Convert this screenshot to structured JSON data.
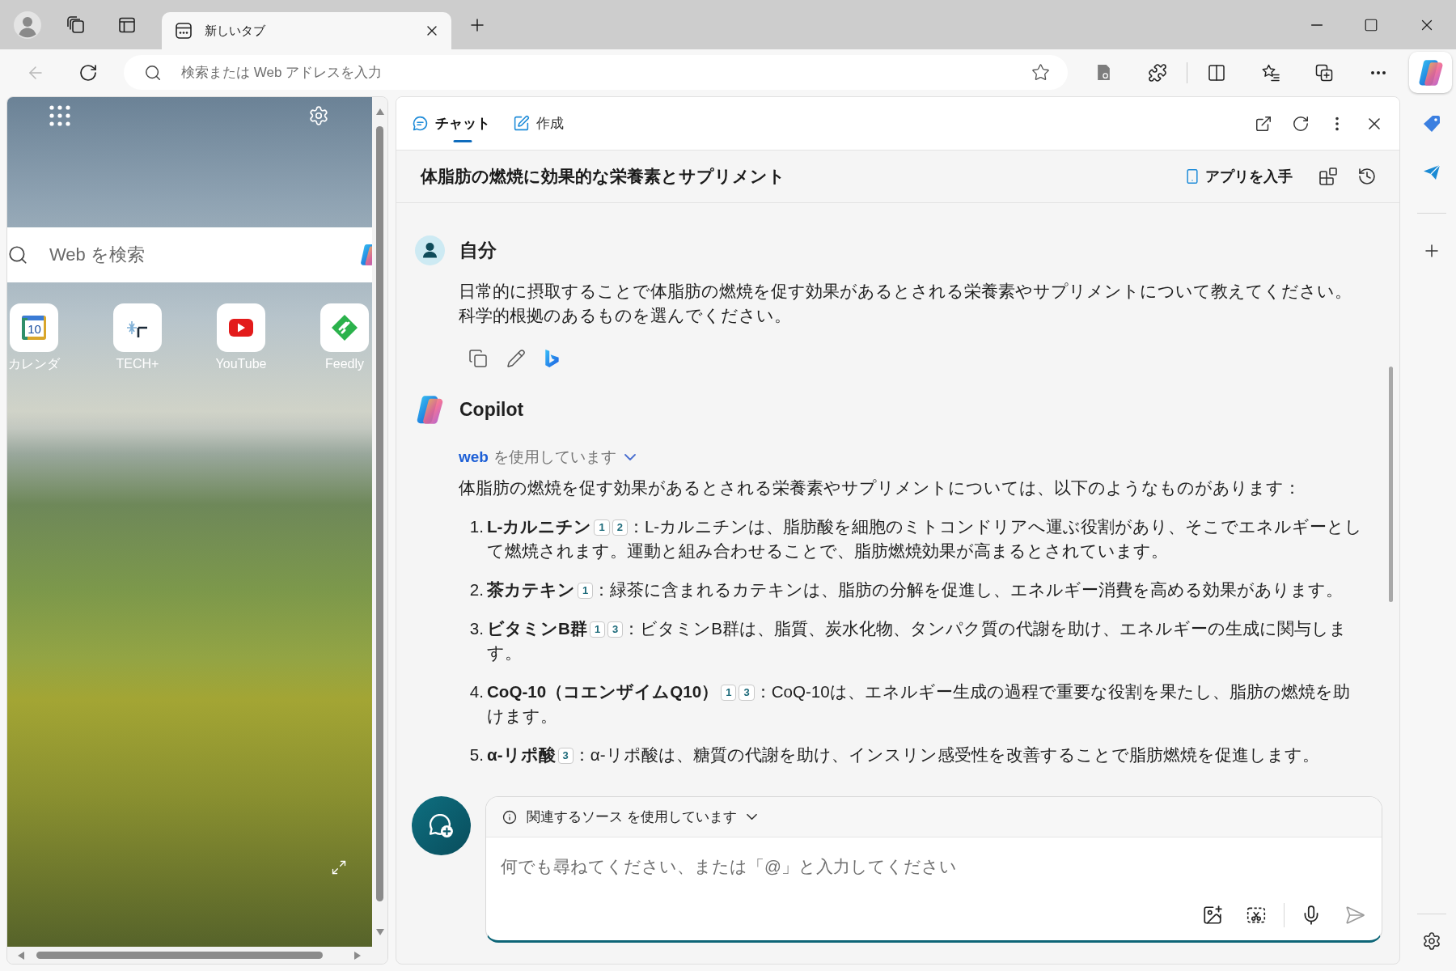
{
  "browser": {
    "tabs": [
      {
        "title": "新しいタブ",
        "selected": true
      }
    ],
    "back_button": {
      "disabled": true
    },
    "address_bar": {
      "placeholder": "検索または Web アドレスを入力"
    },
    "copilot_button": {
      "selected": true
    }
  },
  "new_tab_page": {
    "search": {
      "placeholder": "Web を検索"
    },
    "quick_links": [
      {
        "kind": "calendar",
        "label": "カレンダ",
        "icon_text": "10"
      },
      {
        "kind": "tech",
        "label": "TECH+"
      },
      {
        "kind": "video",
        "label": "YouTube"
      },
      {
        "kind": "reader",
        "label": "Feedly"
      }
    ]
  },
  "copilot": {
    "tabs": [
      {
        "kind": "chat",
        "label": "チャット",
        "selected": true
      },
      {
        "kind": "compose",
        "label": "作成",
        "selected": false
      }
    ],
    "conversation_title": "体脂肪の燃焼に効果的な栄養素とサプリメント",
    "get_app_button": "アプリを入手",
    "messages": [
      {
        "kind": "user",
        "author": "自分",
        "text": "日常的に摂取することで体脂肪の燃焼を促す効果があるとされる栄養素やサプリメントについて教えてください。科学的根拠のあるものを選んでください。"
      },
      {
        "kind": "assistant",
        "author": "Copilot",
        "source": "web",
        "source_suffix": "を使用しています",
        "intro": "体脂肪の燃焼を促す効果があるとされる栄養素やサプリメントについては、以下のようなものがあります：",
        "items": [
          {
            "number": "1.",
            "term": "L-カルニチン",
            "citations": [
              "1",
              "2"
            ],
            "text": "：L-カルニチンは、脂肪酸を細胞のミトコンドリアへ運ぶ役割があり、そこでエネルギーとして燃焼されます。運動と組み合わせることで、脂肪燃焼効果が高まるとされています。"
          },
          {
            "number": "2.",
            "term": "茶カテキン",
            "citations": [
              "1"
            ],
            "text": "：緑茶に含まれるカテキンは、脂肪の分解を促進し、エネルギー消費を高める効果があります。"
          },
          {
            "number": "3.",
            "term": "ビタミンB群",
            "citations": [
              "1",
              "3"
            ],
            "text": "：ビタミンB群は、脂質、炭水化物、タンパク質の代謝を助け、エネルギーの生成に関与します。"
          },
          {
            "number": "4.",
            "term": "CoQ-10（コエンザイムQ10）",
            "citations": [
              "1",
              "3"
            ],
            "text": "：CoQ-10は、エネルギー生成の過程で重要な役割を果たし、脂肪の燃焼を助けます。"
          },
          {
            "number": "5.",
            "term": "α-リポ酸",
            "citations": [
              "3"
            ],
            "text": "：α-リポ酸は、糖質の代謝を助け、インスリン感受性を改善することで脂肪燃焼を促進します。"
          }
        ]
      }
    ],
    "composer": {
      "sources_label": "関連するソース を使用しています",
      "placeholder": "何でも尋ねてください、または「@」と入力してください"
    }
  }
}
